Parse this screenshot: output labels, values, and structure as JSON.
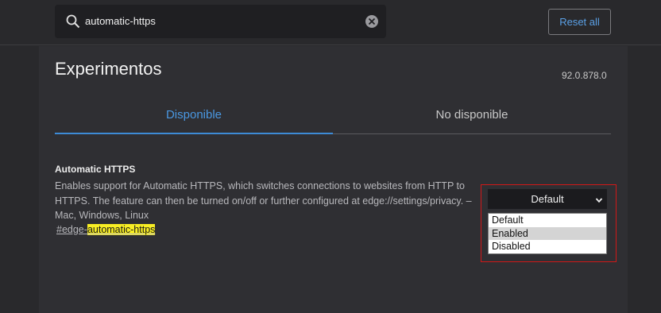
{
  "search": {
    "value": "automatic-https"
  },
  "header": {
    "reset_label": "Reset all"
  },
  "page": {
    "title": "Experimentos",
    "version": "92.0.878.0"
  },
  "tabs": [
    {
      "label": "Disponible",
      "active": true
    },
    {
      "label": "No disponible",
      "active": false
    }
  ],
  "flag": {
    "name": "Automatic HTTPS",
    "description": "Enables support for Automatic HTTPS, which switches connections to websites from HTTP to HTTPS. The feature can then be turned on/off or further configured at edge://settings/privacy. – Mac, Windows, Linux",
    "link_prefix": "#edge-",
    "link_match": "automatic-https",
    "selected": "Default",
    "options": [
      "Default",
      "Enabled",
      "Disabled"
    ]
  },
  "colors": {
    "accent": "#3d8bd6",
    "highlight": "#f8ee24",
    "annotation": "#d11818"
  }
}
